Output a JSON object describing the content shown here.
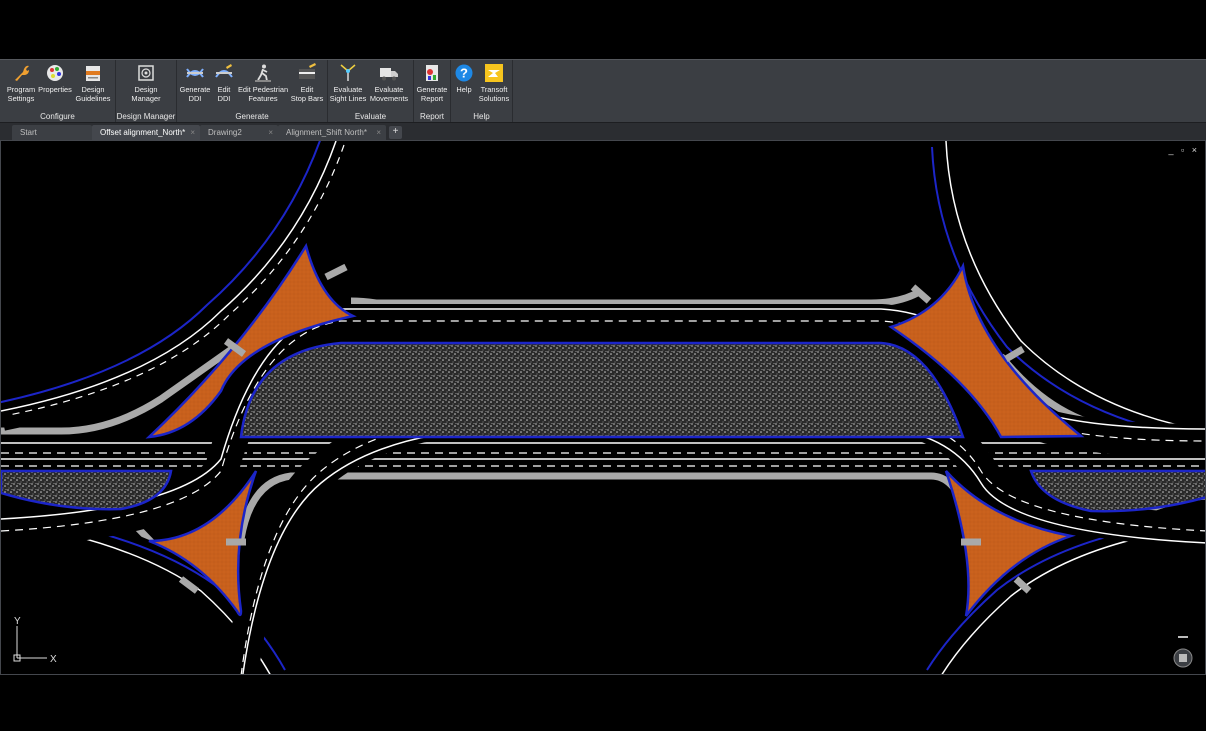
{
  "ribbon": {
    "groups": [
      {
        "label": "Configure",
        "buttons": [
          {
            "label": "Program\nSettings",
            "icon": "wrench-icon"
          },
          {
            "label": "Properties",
            "icon": "palette-icon"
          },
          {
            "label": "Design\nGuidelines",
            "icon": "guidelines-icon"
          }
        ]
      },
      {
        "label": "Design Manager",
        "buttons": [
          {
            "label": "Design\nManager",
            "icon": "design-manager-icon"
          }
        ]
      },
      {
        "label": "Generate",
        "buttons": [
          {
            "label": "Generate\nDDI",
            "icon": "generate-ddi-icon"
          },
          {
            "label": "Edit\nDDI",
            "icon": "edit-ddi-icon"
          },
          {
            "label": "Edit Pedestrian\nFeatures",
            "icon": "pedestrian-icon"
          },
          {
            "label": "Edit\nStop Bars",
            "icon": "stop-bars-icon"
          }
        ]
      },
      {
        "label": "Evaluate",
        "buttons": [
          {
            "label": "Evaluate\nSight Lines",
            "icon": "sight-lines-icon"
          },
          {
            "label": "Evaluate\nMovements",
            "icon": "truck-icon"
          }
        ]
      },
      {
        "label": "Report",
        "buttons": [
          {
            "label": "Generate\nReport",
            "icon": "report-icon"
          }
        ]
      },
      {
        "label": "Help",
        "buttons": [
          {
            "label": "Help",
            "icon": "help-icon"
          },
          {
            "label": "Transoft\nSolutions",
            "icon": "transoft-icon"
          }
        ]
      }
    ]
  },
  "tabs": [
    {
      "label": "Start",
      "active": false
    },
    {
      "label": "Offset alignment_North*",
      "active": true
    },
    {
      "label": "Drawing2",
      "active": false
    },
    {
      "label": "Alignment_Shift North*",
      "active": false
    }
  ],
  "add_tab": "+",
  "viewport": {
    "controls": [
      "_",
      "▫",
      "×"
    ],
    "ucs": {
      "x_label": "X",
      "y_label": "Y"
    }
  },
  "colors": {
    "ribbon_bg": "#3b3e43",
    "island_orange": "#c8601c",
    "island_edge": "#1c25c8",
    "asphalt": "#000000",
    "curb": "#a9a9a9",
    "lane_line": "#ffffff"
  }
}
